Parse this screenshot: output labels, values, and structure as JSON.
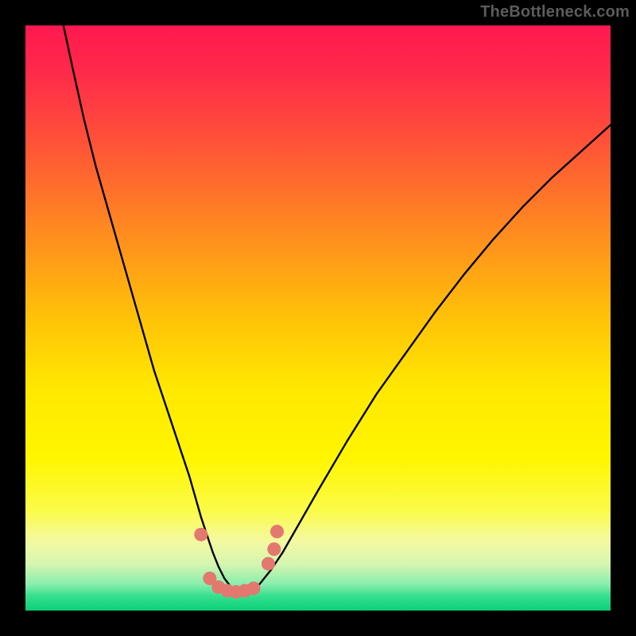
{
  "watermark": "TheBottleneck.com",
  "colors": {
    "frame_bg": "#000000",
    "curve": "#000000",
    "marker": "#e2786e",
    "gradient_stops": [
      {
        "offset": 0.0,
        "color": "#ff1850"
      },
      {
        "offset": 0.08,
        "color": "#ff2a4a"
      },
      {
        "offset": 0.2,
        "color": "#ff5238"
      },
      {
        "offset": 0.35,
        "color": "#ff8a20"
      },
      {
        "offset": 0.5,
        "color": "#ffc208"
      },
      {
        "offset": 0.62,
        "color": "#ffe800"
      },
      {
        "offset": 0.74,
        "color": "#fff600"
      },
      {
        "offset": 0.83,
        "color": "#fbfb4a"
      },
      {
        "offset": 0.88,
        "color": "#f4f9a0"
      },
      {
        "offset": 0.92,
        "color": "#d6f6b0"
      },
      {
        "offset": 0.955,
        "color": "#89eead"
      },
      {
        "offset": 0.975,
        "color": "#37df8e"
      },
      {
        "offset": 1.0,
        "color": "#0bcf78"
      }
    ]
  },
  "chart_data": {
    "type": "line",
    "title": "",
    "xlabel": "",
    "ylabel": "",
    "xlim": [
      0,
      100
    ],
    "ylim": [
      0,
      100
    ],
    "series": [
      {
        "name": "bottleneck-curve",
        "x": [
          6.5,
          8,
          10,
          12,
          14,
          16,
          18,
          20,
          22,
          24,
          26,
          28,
          30,
          31,
          32,
          33,
          34,
          35,
          36,
          37,
          38,
          40,
          42,
          44,
          46,
          48,
          50,
          55,
          60,
          65,
          70,
          75,
          80,
          85,
          90,
          95,
          100
        ],
        "y": [
          100,
          93,
          84,
          76,
          69,
          62,
          55,
          48,
          41,
          35,
          29,
          23,
          16,
          13,
          10,
          7.5,
          5.5,
          4.2,
          3.4,
          3.0,
          3.2,
          4.5,
          7.0,
          10,
          13.5,
          17,
          20.5,
          29,
          37,
          44,
          51,
          57.5,
          63.5,
          69,
          74,
          78.5,
          83
        ]
      }
    ],
    "markers": {
      "name": "measured-points",
      "color": "#e2786e",
      "points": [
        {
          "x": 30.0,
          "y": 13.0
        },
        {
          "x": 31.5,
          "y": 5.5
        },
        {
          "x": 33.0,
          "y": 4.0
        },
        {
          "x": 34.5,
          "y": 3.4
        },
        {
          "x": 36.0,
          "y": 3.2
        },
        {
          "x": 37.5,
          "y": 3.4
        },
        {
          "x": 39.0,
          "y": 3.8
        },
        {
          "x": 41.5,
          "y": 8.0
        },
        {
          "x": 42.5,
          "y": 10.5
        },
        {
          "x": 43.0,
          "y": 13.5
        }
      ]
    }
  }
}
